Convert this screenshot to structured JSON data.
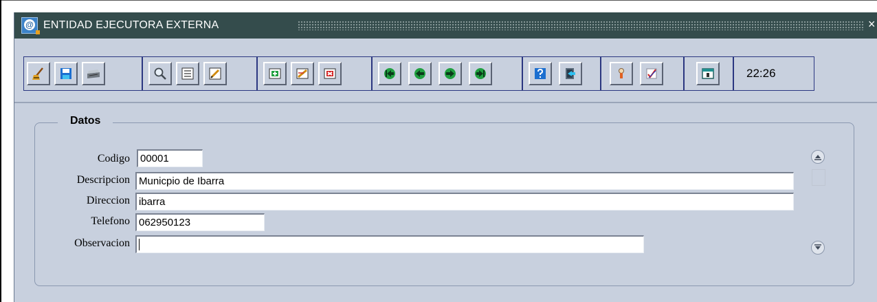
{
  "window": {
    "title": "ENTIDAD EJECUTORA EXTERNA",
    "close_glyph": "×",
    "app_icon": "notebook-at-icon",
    "app_icon_glyph": "@"
  },
  "toolbar": {
    "groups": [
      {
        "buttons": [
          {
            "name": "clear-button",
            "icon": "broom-icon"
          },
          {
            "name": "save-button",
            "icon": "floppy-disk-icon"
          },
          {
            "name": "print-button",
            "icon": "printer-icon"
          }
        ]
      },
      {
        "buttons": [
          {
            "name": "search-button",
            "icon": "magnifier-icon"
          },
          {
            "name": "list-button",
            "icon": "list-icon"
          },
          {
            "name": "edit-button",
            "icon": "pencil-icon"
          }
        ]
      },
      {
        "buttons": [
          {
            "name": "insert-record-button",
            "icon": "insert-record-icon"
          },
          {
            "name": "duplicate-record-button",
            "icon": "duplicate-record-icon"
          },
          {
            "name": "delete-record-button",
            "icon": "delete-record-icon"
          }
        ]
      },
      {
        "buttons": [
          {
            "name": "first-record-button",
            "icon": "first-arrow-icon"
          },
          {
            "name": "previous-record-button",
            "icon": "previous-arrow-icon"
          },
          {
            "name": "next-record-button",
            "icon": "next-arrow-icon"
          },
          {
            "name": "last-record-button",
            "icon": "last-arrow-icon"
          }
        ]
      },
      {
        "buttons": [
          {
            "name": "help-button",
            "icon": "help-icon"
          },
          {
            "name": "exit-button",
            "icon": "exit-door-icon"
          }
        ]
      },
      {
        "buttons": [
          {
            "name": "user-button",
            "icon": "user-icon"
          },
          {
            "name": "check-button",
            "icon": "checkmark-icon"
          }
        ]
      },
      {
        "buttons": [
          {
            "name": "calendar-button",
            "icon": "calendar-icon"
          }
        ]
      }
    ],
    "clock": "22:26"
  },
  "form": {
    "legend": "Datos",
    "fields": {
      "codigo": {
        "label": "Codigo",
        "value": "00001"
      },
      "descripcion": {
        "label": "Descripcion",
        "value": "Municpio de Ibarra"
      },
      "direccion": {
        "label": "Direccion",
        "value": "ibarra"
      },
      "telefono": {
        "label": "Telefono",
        "value": "062950123"
      },
      "observacion": {
        "label": "Observacion",
        "value": ""
      }
    }
  },
  "colors": {
    "titlebar": "#344c4c",
    "window_bg": "#c8d0de",
    "toolbar_group_border": "#2a3680"
  }
}
